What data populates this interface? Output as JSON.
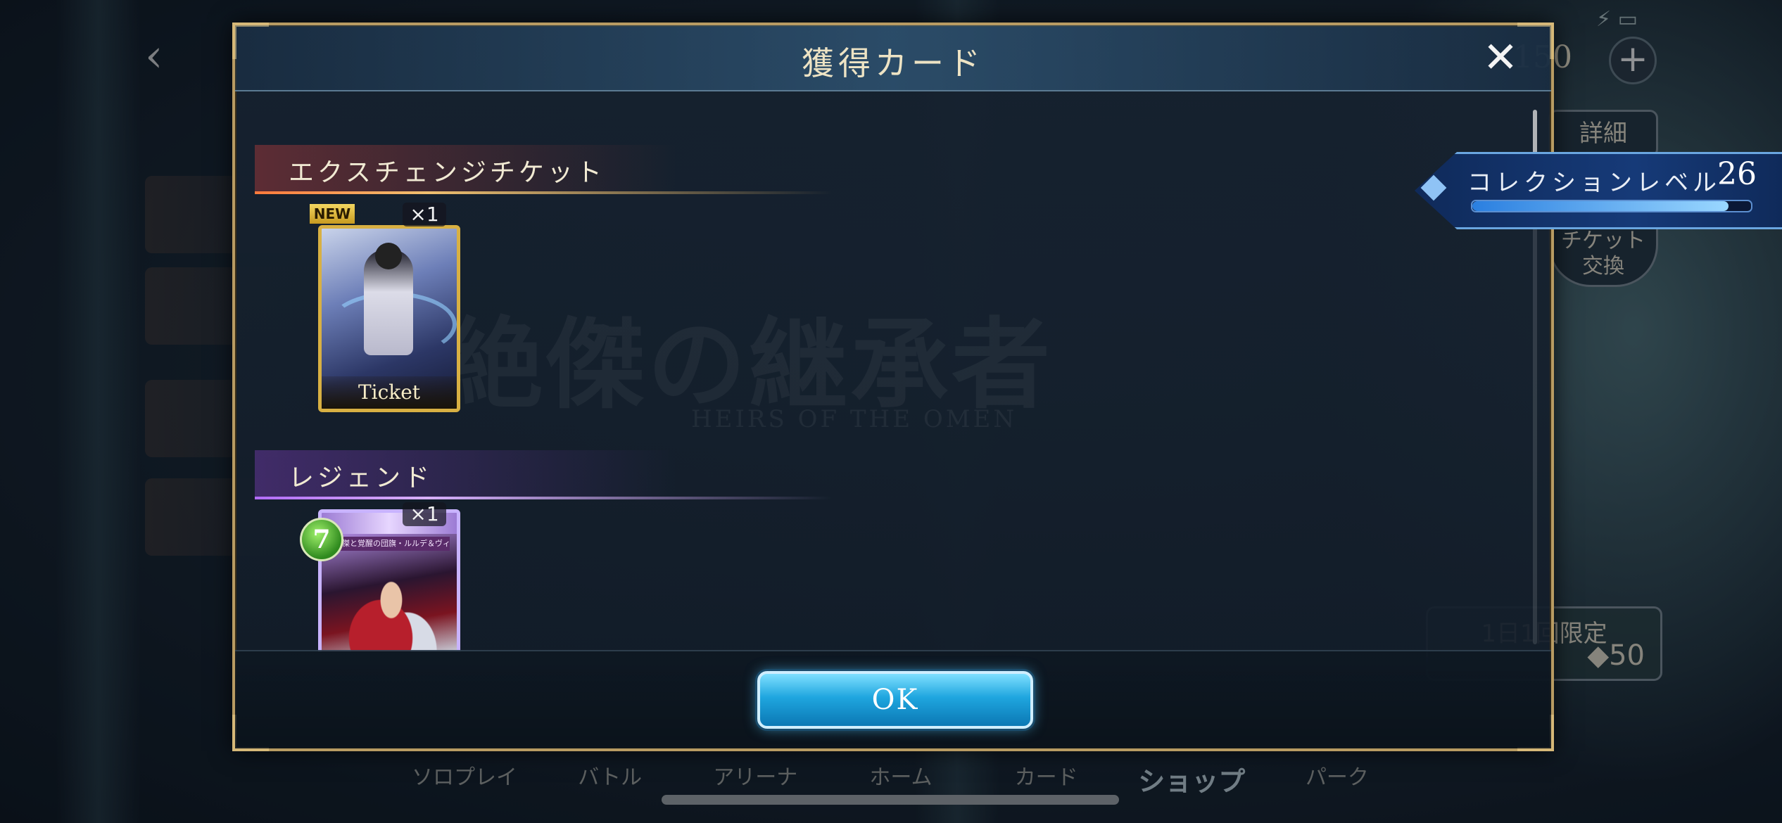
{
  "background": {
    "counter_value": "150",
    "right_buttons": {
      "detail": "詳細",
      "ticket_exchange_line1": "チケット",
      "ticket_exchange_line2": "交換"
    },
    "limited_title": "1日1回限定",
    "limited_price": "50",
    "bottom_nav": [
      "ソロプレイ",
      "バトル",
      "アリーナ",
      "ホーム",
      "カード",
      "ショップ",
      "パーク"
    ],
    "bottom_nav_active_index": 5
  },
  "collection": {
    "label": "コレクションレベル",
    "level": "26",
    "progress_fraction": 0.92
  },
  "modal": {
    "title": "獲得カード",
    "close_icon": "close-icon",
    "watermark": {
      "title": "絶傑の継承者",
      "subtitle": "HEIRS OF THE OMEN"
    },
    "sections": [
      {
        "title": "エクスチェンジチケット",
        "cards": [
          {
            "badge": "NEW",
            "quantity": "×1",
            "footer_label": "Ticket"
          }
        ]
      },
      {
        "title": "レジェンド",
        "cards": [
          {
            "quantity": "×1",
            "cost": "7",
            "name_plate": "絶傑と覚醒の団旗・ルルデ＆ヴィーナッシ"
          }
        ]
      }
    ],
    "ok_button": "OK"
  },
  "colors": {
    "modal_border": "#b89b62",
    "ok_button": "#1fa6df",
    "exchange_accent": "#ff7a3c",
    "legend_accent": "#b26cff",
    "collection_bar": "#2a7fe0"
  }
}
